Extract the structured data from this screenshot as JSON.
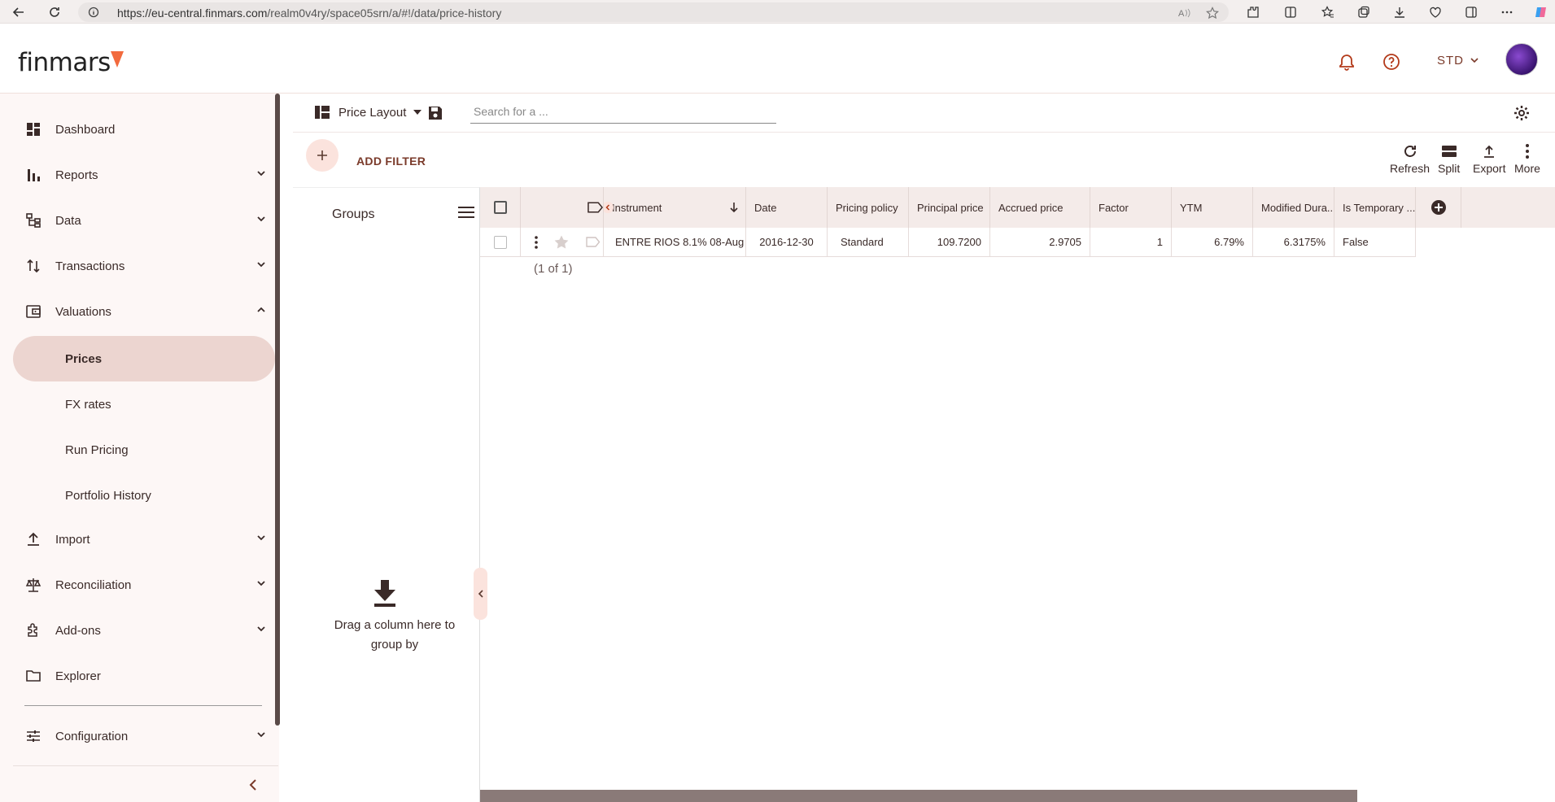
{
  "browser": {
    "url_host": "https://eu-central.finmars.com",
    "url_path": "/realm0v4ry/space05srn/a/#!/data/price-history"
  },
  "header": {
    "logo_text": "finmars",
    "user_menu_label": "STD",
    "brand_color": "#f26a3d"
  },
  "sidebar": {
    "items": [
      {
        "label": "Dashboard",
        "icon": "dashboard-icon"
      },
      {
        "label": "Reports",
        "icon": "bar-chart-icon"
      },
      {
        "label": "Data",
        "icon": "data-tree-icon"
      },
      {
        "label": "Transactions",
        "icon": "swap-vertical-icon"
      },
      {
        "label": "Valuations",
        "icon": "wallet-icon"
      },
      {
        "label": "Import",
        "icon": "upload-icon"
      },
      {
        "label": "Reconciliation",
        "icon": "scale-icon"
      },
      {
        "label": "Add-ons",
        "icon": "puzzle-icon"
      },
      {
        "label": "Explorer",
        "icon": "folder-icon"
      },
      {
        "label": "Configuration",
        "icon": "sliders-icon"
      }
    ],
    "valuations_sub": [
      "Prices",
      "FX rates",
      "Run Pricing",
      "Portfolio History"
    ],
    "active_sub": "Prices"
  },
  "toolbar": {
    "layout_label": "Price Layout",
    "search_placeholder": "Search for a ...",
    "add_filter_label": "ADD FILTER",
    "refresh_label": "Refresh",
    "split_label": "Split",
    "export_label": "Export",
    "more_label": "More"
  },
  "groups": {
    "title": "Groups",
    "drag_hint": "Drag a column here to group by"
  },
  "table": {
    "columns": [
      "Instrument",
      "Date",
      "Pricing policy",
      "Principal price",
      "Accrued price",
      "Factor",
      "YTM",
      "Modified Dura...",
      "Is Temporary ..."
    ],
    "rows": [
      [
        "ENTRE RIOS 8.1% 08-Aug",
        "2016-12-30",
        "Standard",
        "109.7200",
        "2.9705",
        "1",
        "6.79%",
        "6.3175%",
        "False"
      ]
    ],
    "pagination": "(1 of 1)"
  }
}
